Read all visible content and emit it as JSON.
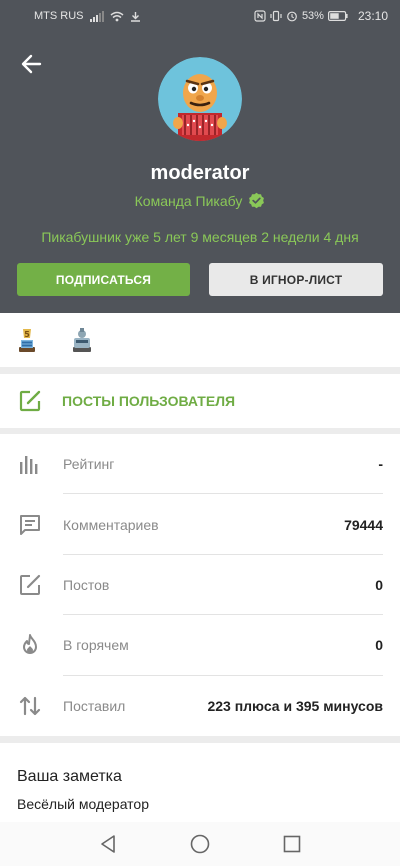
{
  "status_bar": {
    "carrier": "MTS RUS",
    "battery": "53%",
    "time": "23:10"
  },
  "profile": {
    "username": "moderator",
    "team": "Команда Пикабу",
    "since": "Пикабушник уже 5 лет 9 месяцев 2 недели 4 дня",
    "subscribe_label": "ПОДПИСАТЬСЯ",
    "ignore_label": "В ИГНОР-ЛИСТ"
  },
  "posts_link": {
    "label": "ПОСТЫ ПОЛЬЗОВАТЕЛЯ"
  },
  "stats": [
    {
      "label": "Рейтинг",
      "value": "-"
    },
    {
      "label": "Комментариев",
      "value": "79444"
    },
    {
      "label": "Постов",
      "value": "0"
    },
    {
      "label": "В горячем",
      "value": "0"
    },
    {
      "label": "Поставил",
      "value": "223 плюса и 395 минусов"
    }
  ],
  "note": {
    "title": "Ваша заметка",
    "text": "Весёлый модератор"
  },
  "colors": {
    "header_bg": "#50545a",
    "accent_green": "#73b047",
    "green_text": "#8ac858"
  }
}
